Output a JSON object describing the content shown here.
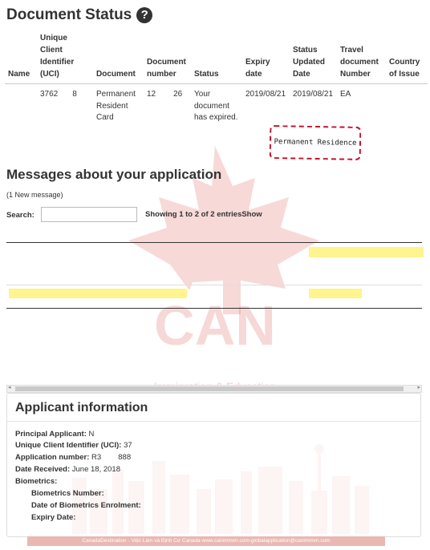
{
  "document_status": {
    "title": "Document Status",
    "help_icon": "question-circle-icon",
    "columns": [
      "Name",
      "Unique Client Identifier (UCI)",
      "Document",
      "Document number",
      "Status",
      "Expiry date",
      "Status Updated Date",
      "Travel document Number",
      "Country of Issue"
    ],
    "row": {
      "name": "",
      "uci_a": "3762",
      "uci_b": "8",
      "document": "Permanent Resident Card",
      "doc_no_a": "12",
      "doc_no_b": "26",
      "status": "Your document has expired.",
      "expiry": "2019/08/21",
      "updated": "2019/08/21",
      "travel_doc": "EA",
      "country": ""
    },
    "stamp": "Permanent Residence"
  },
  "messages": {
    "title": "Messages about your application",
    "new_count": "(1 New message)",
    "search_label": "Search:",
    "search_value": "",
    "showing": "Showing 1 to 2 of 2 entriesShow"
  },
  "applicant": {
    "title": "Applicant information",
    "fields": [
      {
        "label": "Principal Applicant:",
        "value": "N"
      },
      {
        "label": "Unique Client Identifier (UCI):",
        "value": "37"
      },
      {
        "label": "Application number:",
        "value": "R3        888"
      },
      {
        "label": "Date Received:",
        "value": "June 18, 2018"
      },
      {
        "label": "Biometrics:",
        "value": ""
      }
    ],
    "biometrics": [
      {
        "label": "Biometrics Number:",
        "value": ""
      },
      {
        "label": "Date of Biometrics Enrolment:",
        "value": ""
      },
      {
        "label": "Expiry Date:",
        "value": ""
      }
    ]
  },
  "watermark": {
    "brand": "CAN",
    "tagline": "Immigration & Education",
    "color": "#d9534f"
  },
  "footer": "CanadaDestination - Việc Làm và Định Cư Canada www.canimmvn.com-globalapplication@canimmvn.com"
}
